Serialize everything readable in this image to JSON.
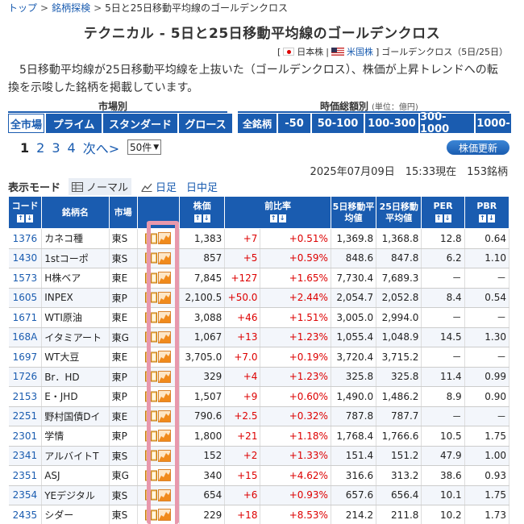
{
  "breadcrumb": [
    "トップ",
    "銘柄探検",
    "5日と25日移動平均線のゴールデンクロス"
  ],
  "title": "テクニカル - 5日と25日移動平均線のゴールデンクロス",
  "flags": {
    "jp": "日本株",
    "us": "米国株",
    "suffix": "ゴールデンクロス（5日/25日）"
  },
  "description": "5日移動平均線が25日移動平均線を上抜いた（ゴールデンクロス）、株価が上昇トレンドへの転換を示唆した銘柄を掲載しています。",
  "market_section": {
    "label": "市場別",
    "buttons": [
      "全市場",
      "プライム",
      "スタンダード",
      "グロース"
    ],
    "active": 0
  },
  "cap_section": {
    "label": "時価総額別",
    "unit": "(単位：億円)",
    "buttons": [
      "全銘柄",
      "-50",
      "50-100",
      "100-300",
      "300-1000",
      "1000-"
    ]
  },
  "pager": {
    "current": "1",
    "pages": [
      "2",
      "3",
      "4"
    ],
    "next": "次へ>"
  },
  "per_page": "50件",
  "update_button": "株価更新",
  "timestamp": "2025年07月09日　15:33現在　153銘柄",
  "mode": {
    "label": "表示モード",
    "items": [
      "ノーマル",
      "日足",
      "日中足"
    ]
  },
  "headers": {
    "code": "コード",
    "name": "銘柄名",
    "market": "市場",
    "price": "株価",
    "change": "前比率",
    "ma5": "5日移動平均値",
    "ma25": "25日移動平均値",
    "per": "PER",
    "pbr": "PBR",
    "sort_up": "↑",
    "sort_down": "↓"
  },
  "rows": [
    {
      "code": "1376",
      "name": "カネコ種",
      "market": "東S",
      "price": "1,383",
      "chg": "+7",
      "pct": "+0.51%",
      "ma5": "1,369.8",
      "ma25": "1,368.8",
      "per": "12.8",
      "pbr": "0.64"
    },
    {
      "code": "1430",
      "name": "1stコーポ",
      "market": "東S",
      "price": "857",
      "chg": "+5",
      "pct": "+0.59%",
      "ma5": "848.6",
      "ma25": "847.8",
      "per": "6.2",
      "pbr": "1.10"
    },
    {
      "code": "1573",
      "name": "H株ベア",
      "market": "東E",
      "price": "7,845",
      "chg": "+127",
      "pct": "+1.65%",
      "ma5": "7,730.4",
      "ma25": "7,689.3",
      "per": "－",
      "pbr": "－"
    },
    {
      "code": "1605",
      "name": "INPEX",
      "market": "東P",
      "price": "2,100.5",
      "chg": "+50.0",
      "pct": "+2.44%",
      "ma5": "2,054.7",
      "ma25": "2,052.8",
      "per": "8.4",
      "pbr": "0.54"
    },
    {
      "code": "1671",
      "name": "WTI原油",
      "market": "東E",
      "price": "3,088",
      "chg": "+46",
      "pct": "+1.51%",
      "ma5": "3,005.0",
      "ma25": "2,994.0",
      "per": "－",
      "pbr": "－"
    },
    {
      "code": "168A",
      "name": "イタミアート",
      "market": "東G",
      "price": "1,067",
      "chg": "+13",
      "pct": "+1.23%",
      "ma5": "1,055.4",
      "ma25": "1,048.9",
      "per": "14.5",
      "pbr": "1.30"
    },
    {
      "code": "1697",
      "name": "WT大豆",
      "market": "東E",
      "price": "3,705.0",
      "chg": "+7.0",
      "pct": "+0.19%",
      "ma5": "3,720.4",
      "ma25": "3,715.2",
      "per": "－",
      "pbr": "－"
    },
    {
      "code": "1726",
      "name": "Br．HD",
      "market": "東P",
      "price": "329",
      "chg": "+4",
      "pct": "+1.23%",
      "ma5": "325.8",
      "ma25": "325.8",
      "per": "11.4",
      "pbr": "0.99"
    },
    {
      "code": "2153",
      "name": "E・JHD",
      "market": "東P",
      "price": "1,507",
      "chg": "+9",
      "pct": "+0.60%",
      "ma5": "1,490.0",
      "ma25": "1,486.2",
      "per": "8.9",
      "pbr": "0.90"
    },
    {
      "code": "2251",
      "name": "野村国債Dイ",
      "market": "東E",
      "price": "790.6",
      "chg": "+2.5",
      "pct": "+0.32%",
      "ma5": "787.8",
      "ma25": "787.7",
      "per": "－",
      "pbr": "－"
    },
    {
      "code": "2301",
      "name": "学情",
      "market": "東P",
      "price": "1,800",
      "chg": "+21",
      "pct": "+1.18%",
      "ma5": "1,768.4",
      "ma25": "1,766.6",
      "per": "10.5",
      "pbr": "1.75"
    },
    {
      "code": "2341",
      "name": "アルバイトT",
      "market": "東S",
      "price": "152",
      "chg": "+2",
      "pct": "+1.33%",
      "ma5": "151.4",
      "ma25": "151.2",
      "per": "47.9",
      "pbr": "1.00"
    },
    {
      "code": "2351",
      "name": "ASJ",
      "market": "東G",
      "price": "340",
      "chg": "+15",
      "pct": "+4.62%",
      "ma5": "316.6",
      "ma25": "313.2",
      "per": "38.6",
      "pbr": "0.93"
    },
    {
      "code": "2354",
      "name": "YEデジタル",
      "market": "東S",
      "price": "654",
      "chg": "+6",
      "pct": "+0.93%",
      "ma5": "657.6",
      "ma25": "656.4",
      "per": "10.1",
      "pbr": "1.75"
    },
    {
      "code": "2435",
      "name": "シダー",
      "market": "東S",
      "price": "229",
      "chg": "+18",
      "pct": "+8.53%",
      "ma5": "214.2",
      "ma25": "211.8",
      "per": "10.2",
      "pbr": "1.73"
    }
  ],
  "colors": {
    "accent": "#1a5cb0",
    "up": "#dd0000",
    "highlight": "#e898ac"
  }
}
